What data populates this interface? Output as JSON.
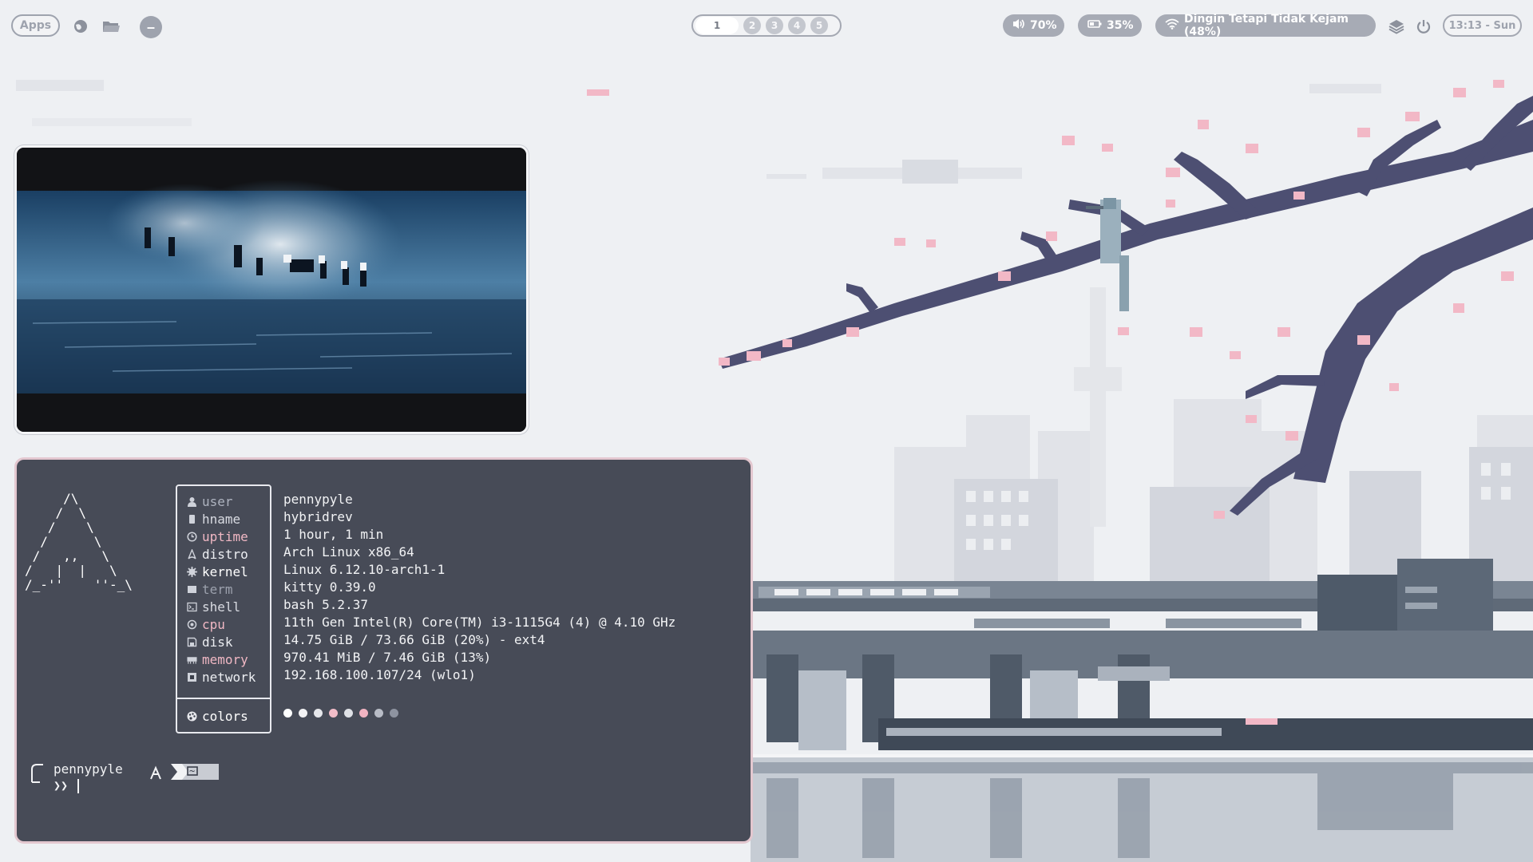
{
  "topbar": {
    "apps_label": "Apps",
    "workspaces": [
      "1",
      "2",
      "3",
      "4",
      "5"
    ],
    "active_workspace": "1",
    "volume": "70%",
    "battery": "35%",
    "wifi": "Dingin Tetapi Tidak Kejam (48%)",
    "clock": "13:13 - Sun"
  },
  "fetch": {
    "logo": "     /\\\n    /  \\\n   /    \\\n  /      \\\n /   ,,   \\\n/   |  |   \\\n/_-''    ''-_\\",
    "rows": [
      {
        "icon": "user-icon",
        "key": "user",
        "value": "pennypyle",
        "color": "#aeb3bf"
      },
      {
        "icon": "host-icon",
        "key": "hname",
        "value": "hybridrev",
        "color": "#d9dbe2"
      },
      {
        "icon": "clock-icon",
        "key": "uptime",
        "value": "1 hour, 1 min",
        "color": "#f0b8c4"
      },
      {
        "icon": "arch-icon",
        "key": "distro",
        "value": "Arch Linux x86_64",
        "color": "#eceef2"
      },
      {
        "icon": "gear-icon",
        "key": "kernel",
        "value": "Linux 6.12.10-arch1-1",
        "color": "#ffffff"
      },
      {
        "icon": "terminal-icon",
        "key": "term",
        "value": "kitty 0.39.0",
        "color": "#9ca1ad"
      },
      {
        "icon": "shell-icon",
        "key": "shell",
        "value": "bash 5.2.37",
        "color": "#d9dbe2"
      },
      {
        "icon": "cpu-icon",
        "key": "cpu",
        "value": "11th Gen Intel(R) Core(TM) i3-1115G4 (4) @ 4.10 GHz",
        "color": "#f0b8c4"
      },
      {
        "icon": "disk-icon",
        "key": "disk",
        "value": "14.75 GiB / 73.66 GiB (20%) - ext4",
        "color": "#eceef2"
      },
      {
        "icon": "memory-icon",
        "key": "memory",
        "value": "970.41 MiB / 7.46 GiB (13%)",
        "color": "#f0b8c4"
      },
      {
        "icon": "network-icon",
        "key": "network",
        "value": "192.168.100.107/24 (wlo1)",
        "color": "#eceef2"
      }
    ],
    "colors_key": "colors",
    "palette": [
      "#ffffff",
      "#f2f2f4",
      "#e6e7eb",
      "#f2bdc9",
      "#dfe1e6",
      "#f2b4c2",
      "#b8bcc6",
      "#8e93a0"
    ]
  },
  "prompt": {
    "user": "pennypyle",
    "dir": "~",
    "symbol": "❯❯"
  }
}
